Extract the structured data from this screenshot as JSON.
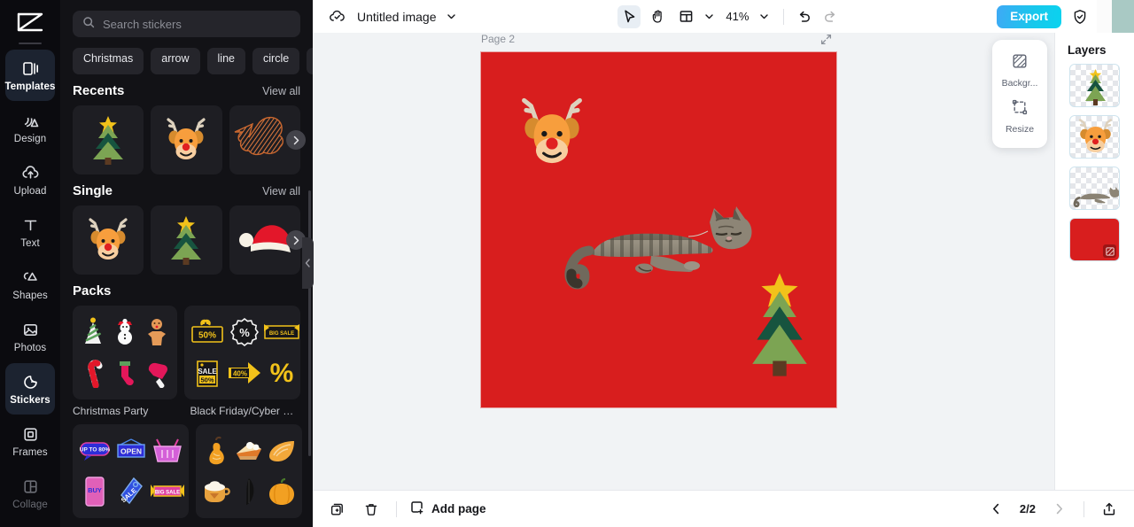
{
  "rail": {
    "logo_icon": "capcut-logo-icon",
    "items": [
      {
        "label": "Templates",
        "icon": "templates-icon",
        "active": true
      },
      {
        "label": "Design",
        "icon": "design-icon",
        "active": false
      },
      {
        "label": "Upload",
        "icon": "upload-cloud-icon",
        "active": false
      },
      {
        "label": "Text",
        "icon": "text-icon",
        "active": false
      },
      {
        "label": "Shapes",
        "icon": "shapes-icon",
        "active": false
      },
      {
        "label": "Photos",
        "icon": "photos-icon",
        "active": false
      },
      {
        "label": "Stickers",
        "icon": "stickers-icon",
        "active": true
      },
      {
        "label": "Frames",
        "icon": "frames-icon",
        "active": false
      },
      {
        "label": "Collage",
        "icon": "collage-icon",
        "active": false
      }
    ]
  },
  "panel": {
    "search": {
      "placeholder": "Search stickers",
      "value": "",
      "icon": "search-icon"
    },
    "chips": [
      "Christmas",
      "arrow",
      "line",
      "circle"
    ],
    "sections": [
      {
        "title": "Recents",
        "view_all": "View all"
      },
      {
        "title": "Single",
        "view_all": "View all"
      },
      {
        "title": "Packs",
        "view_all": ""
      }
    ],
    "recents": [
      "christmas-tree-sticker",
      "reindeer-sticker",
      "scribble-cloud-sticker"
    ],
    "single": [
      "reindeer-sticker",
      "christmas-tree-sticker",
      "santa-hat-sticker"
    ],
    "packs": [
      {
        "label": "Christmas Party"
      },
      {
        "label": "Black Friday/Cyber Mon..."
      },
      {
        "label": ""
      },
      {
        "label": ""
      }
    ],
    "next_arrow_icon": "chevron-right-icon",
    "collapse_icon": "chevron-left-icon"
  },
  "topbar": {
    "cloud_icon": "cloud-saved-icon",
    "title": "Untitled image",
    "title_caret_icon": "chevron-down-icon",
    "tools": [
      {
        "name": "select-tool",
        "icon": "cursor-icon",
        "selected": true
      },
      {
        "name": "hand-tool",
        "icon": "hand-icon",
        "selected": false
      },
      {
        "name": "layout-tool",
        "icon": "layout-icon",
        "selected": false
      }
    ],
    "layout_caret_icon": "chevron-down-icon",
    "zoom": "41%",
    "zoom_caret_icon": "chevron-down-icon",
    "undo_icon": "undo-icon",
    "redo_icon": "redo-icon",
    "export_label": "Export",
    "shield_icon": "shield-check-icon"
  },
  "canvas": {
    "page_label": "Page 2",
    "expand_icon": "expand-page-icon",
    "background_color": "#d81e1e",
    "elements": [
      "reindeer-sticker",
      "cat-photo",
      "christmas-tree-sticker"
    ]
  },
  "float_tools": [
    {
      "label": "Backgr...",
      "icon": "background-icon"
    },
    {
      "label": "Resize",
      "icon": "resize-icon"
    }
  ],
  "layers": {
    "title": "Layers",
    "items": [
      {
        "name": "christmas-tree-layer",
        "type": "sticker"
      },
      {
        "name": "reindeer-layer",
        "type": "sticker"
      },
      {
        "name": "cat-layer",
        "type": "image"
      },
      {
        "name": "background-layer",
        "type": "background",
        "color": "#d81e1e",
        "badge_icon": "background-icon"
      }
    ]
  },
  "bottombar": {
    "duplicate_icon": "duplicate-page-icon",
    "delete_icon": "trash-icon",
    "add_page_label": "Add page",
    "add_page_icon": "add-page-icon",
    "prev_icon": "chevron-left-icon",
    "next_icon": "chevron-right-icon",
    "page_count": "2/2",
    "export_page_icon": "export-page-icon"
  },
  "colors": {
    "accent": "#0ad3ef",
    "canvas_red": "#d81e1e",
    "panel_bg": "#121216",
    "rail_bg": "#0b0b0f"
  }
}
